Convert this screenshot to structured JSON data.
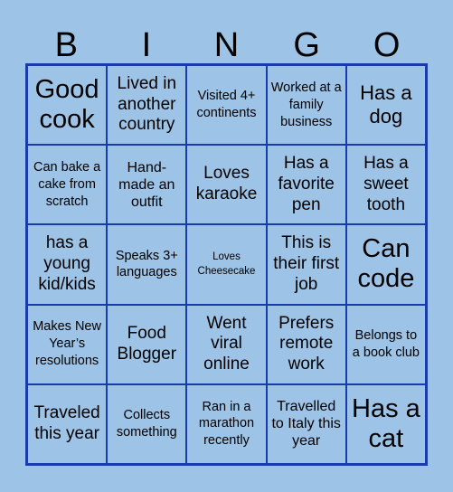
{
  "title_letters": [
    "B",
    "I",
    "N",
    "G",
    "O"
  ],
  "colors": {
    "background": "#9dc3e6",
    "grid_line": "#1a3caa",
    "text": "#000000"
  },
  "board": {
    "rows": [
      [
        {
          "text": "Good cook",
          "size": "xl"
        },
        {
          "text": "Lived in another country",
          "size": "m"
        },
        {
          "text": "Visited 4+ continents",
          "size": "s"
        },
        {
          "text": "Worked at a family business",
          "size": "s"
        },
        {
          "text": "Has a dog",
          "size": "l"
        }
      ],
      [
        {
          "text": "Can bake a cake from scratch",
          "size": "s"
        },
        {
          "text": "Hand-made an outfit",
          "size": "sm"
        },
        {
          "text": "Loves karaoke",
          "size": "m"
        },
        {
          "text": "Has a favorite pen",
          "size": "m"
        },
        {
          "text": "Has a sweet tooth",
          "size": "m"
        }
      ],
      [
        {
          "text": "has a young kid/kids",
          "size": "m"
        },
        {
          "text": "Speaks 3+ languages",
          "size": "s"
        },
        {
          "text": "Loves Cheesecake",
          "size": "xs"
        },
        {
          "text": "This is their first job",
          "size": "m"
        },
        {
          "text": "Can code",
          "size": "xl"
        }
      ],
      [
        {
          "text": "Makes New Year’s resolutions",
          "size": "s"
        },
        {
          "text": "Food Blogger",
          "size": "m"
        },
        {
          "text": "Went viral online",
          "size": "m"
        },
        {
          "text": "Prefers remote work",
          "size": "m"
        },
        {
          "text": "Belongs to a book club",
          "size": "s"
        }
      ],
      [
        {
          "text": "Traveled this year",
          "size": "m"
        },
        {
          "text": "Collects something",
          "size": "s"
        },
        {
          "text": "Ran in a marathon recently",
          "size": "s"
        },
        {
          "text": "Travelled to Italy this year",
          "size": "sm"
        },
        {
          "text": "Has a cat",
          "size": "xl"
        }
      ]
    ]
  }
}
